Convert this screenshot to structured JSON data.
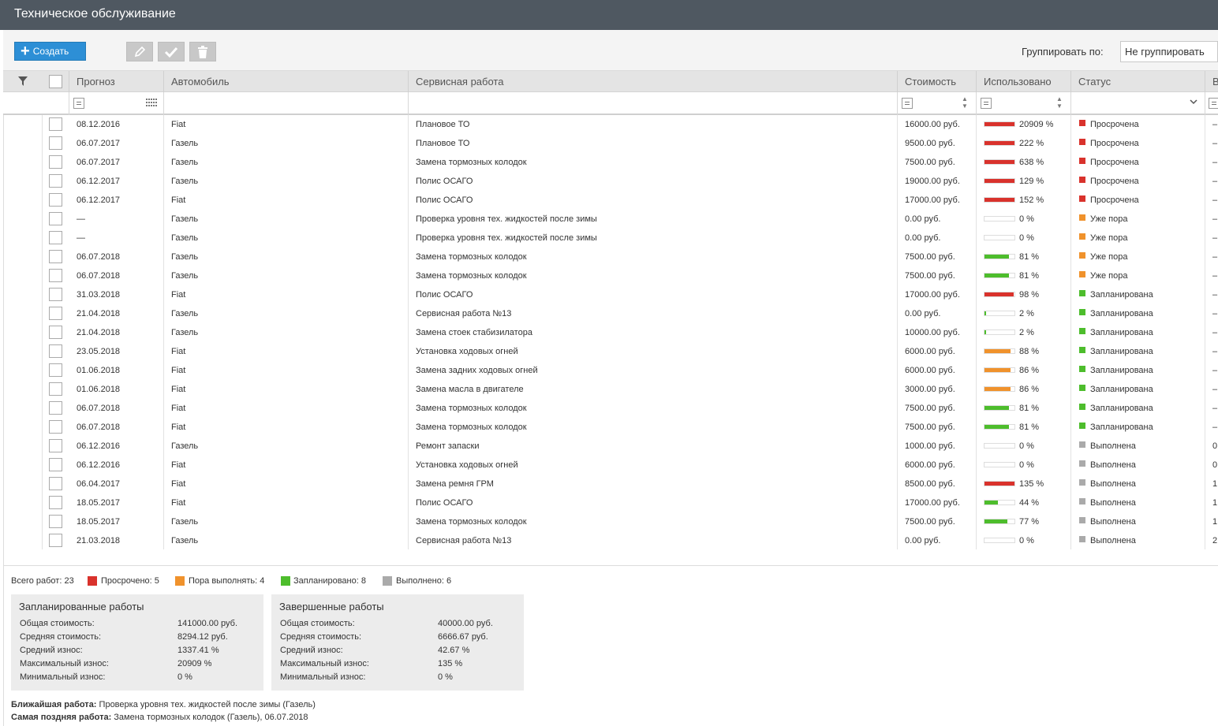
{
  "window": {
    "title": "Техническое обслуживание"
  },
  "toolbar": {
    "create_label": "Создать",
    "group_by_label": "Группировать по:",
    "group_by_value": "Не группировать"
  },
  "columns": {
    "forecast": "Прогноз",
    "car": "Автомобиль",
    "service": "Сервисная работа",
    "cost": "Стоимость",
    "used": "Использовано",
    "status": "Статус",
    "extra": "В"
  },
  "colors": {
    "red": "#d9322c",
    "orange": "#f0922c",
    "green": "#4dbd2c",
    "gray": "#aaaaaa"
  },
  "rows": [
    {
      "date": "08.12.2016",
      "car": "Fiat",
      "service": "Плановое ТО",
      "cost": "16000.00 руб.",
      "used": "20909 %",
      "used_fraction": 1.0,
      "bar_color": "red",
      "status": "Просрочена",
      "status_color": "red",
      "extra": "–"
    },
    {
      "date": "06.07.2017",
      "car": "Газель",
      "service": "Плановое ТО",
      "cost": "9500.00 руб.",
      "used": "222 %",
      "used_fraction": 1.0,
      "bar_color": "red",
      "status": "Просрочена",
      "status_color": "red",
      "extra": "–"
    },
    {
      "date": "06.07.2017",
      "car": "Газель",
      "service": "Замена тормозных колодок",
      "cost": "7500.00 руб.",
      "used": "638 %",
      "used_fraction": 1.0,
      "bar_color": "red",
      "status": "Просрочена",
      "status_color": "red",
      "extra": "–"
    },
    {
      "date": "06.12.2017",
      "car": "Газель",
      "service": "Полис ОСАГО",
      "cost": "19000.00 руб.",
      "used": "129 %",
      "used_fraction": 1.0,
      "bar_color": "red",
      "status": "Просрочена",
      "status_color": "red",
      "extra": "–"
    },
    {
      "date": "06.12.2017",
      "car": "Fiat",
      "service": "Полис ОСАГО",
      "cost": "17000.00 руб.",
      "used": "152 %",
      "used_fraction": 1.0,
      "bar_color": "red",
      "status": "Просрочена",
      "status_color": "red",
      "extra": "–"
    },
    {
      "date": "—",
      "car": "Газель",
      "service": "Проверка уровня тех. жидкостей после зимы",
      "cost": "0.00 руб.",
      "used": "0 %",
      "used_fraction": 0.0,
      "bar_color": "gray",
      "status": "Уже пора",
      "status_color": "orange",
      "extra": "–"
    },
    {
      "date": "—",
      "car": "Газель",
      "service": "Проверка уровня тех. жидкостей после зимы",
      "cost": "0.00 руб.",
      "used": "0 %",
      "used_fraction": 0.0,
      "bar_color": "gray",
      "status": "Уже пора",
      "status_color": "orange",
      "extra": "–"
    },
    {
      "date": "06.07.2018",
      "car": "Газель",
      "service": "Замена тормозных колодок",
      "cost": "7500.00 руб.",
      "used": "81 %",
      "used_fraction": 0.81,
      "bar_color": "green",
      "status": "Уже пора",
      "status_color": "orange",
      "extra": "–"
    },
    {
      "date": "06.07.2018",
      "car": "Газель",
      "service": "Замена тормозных колодок",
      "cost": "7500.00 руб.",
      "used": "81 %",
      "used_fraction": 0.81,
      "bar_color": "green",
      "status": "Уже пора",
      "status_color": "orange",
      "extra": "–"
    },
    {
      "date": "31.03.2018",
      "car": "Fiat",
      "service": "Полис ОСАГО",
      "cost": "17000.00 руб.",
      "used": "98 %",
      "used_fraction": 0.98,
      "bar_color": "red",
      "status": "Запланирована",
      "status_color": "green",
      "extra": "–"
    },
    {
      "date": "21.04.2018",
      "car": "Газель",
      "service": "Сервисная работа №13",
      "cost": "0.00 руб.",
      "used": "2 %",
      "used_fraction": 0.02,
      "bar_color": "green",
      "status": "Запланирована",
      "status_color": "green",
      "extra": "–"
    },
    {
      "date": "21.04.2018",
      "car": "Газель",
      "service": "Замена стоек стабизилатора",
      "cost": "10000.00 руб.",
      "used": "2 %",
      "used_fraction": 0.02,
      "bar_color": "green",
      "status": "Запланирована",
      "status_color": "green",
      "extra": "–"
    },
    {
      "date": "23.05.2018",
      "car": "Fiat",
      "service": "Установка ходовых огней",
      "cost": "6000.00 руб.",
      "used": "88 %",
      "used_fraction": 0.88,
      "bar_color": "orange",
      "status": "Запланирована",
      "status_color": "green",
      "extra": "–"
    },
    {
      "date": "01.06.2018",
      "car": "Fiat",
      "service": "Замена задних ходовых огней",
      "cost": "6000.00 руб.",
      "used": "86 %",
      "used_fraction": 0.86,
      "bar_color": "orange",
      "status": "Запланирована",
      "status_color": "green",
      "extra": "–"
    },
    {
      "date": "01.06.2018",
      "car": "Fiat",
      "service": "Замена масла в двигателе",
      "cost": "3000.00 руб.",
      "used": "86 %",
      "used_fraction": 0.86,
      "bar_color": "orange",
      "status": "Запланирована",
      "status_color": "green",
      "extra": "–"
    },
    {
      "date": "06.07.2018",
      "car": "Fiat",
      "service": "Замена тормозных колодок",
      "cost": "7500.00 руб.",
      "used": "81 %",
      "used_fraction": 0.81,
      "bar_color": "green",
      "status": "Запланирована",
      "status_color": "green",
      "extra": "–"
    },
    {
      "date": "06.07.2018",
      "car": "Fiat",
      "service": "Замена тормозных колодок",
      "cost": "7500.00 руб.",
      "used": "81 %",
      "used_fraction": 0.81,
      "bar_color": "green",
      "status": "Запланирована",
      "status_color": "green",
      "extra": "–"
    },
    {
      "date": "06.12.2016",
      "car": "Газель",
      "service": "Ремонт запаски",
      "cost": "1000.00 руб.",
      "used": "0 %",
      "used_fraction": 0.0,
      "bar_color": "gray",
      "status": "Выполнена",
      "status_color": "gray",
      "extra": "0"
    },
    {
      "date": "06.12.2016",
      "car": "Fiat",
      "service": "Установка ходовых огней",
      "cost": "6000.00 руб.",
      "used": "0 %",
      "used_fraction": 0.0,
      "bar_color": "gray",
      "status": "Выполнена",
      "status_color": "gray",
      "extra": "0"
    },
    {
      "date": "06.04.2017",
      "car": "Fiat",
      "service": "Замена ремня ГРМ",
      "cost": "8500.00 руб.",
      "used": "135 %",
      "used_fraction": 1.0,
      "bar_color": "red",
      "status": "Выполнена",
      "status_color": "gray",
      "extra": "1"
    },
    {
      "date": "18.05.2017",
      "car": "Fiat",
      "service": "Полис ОСАГО",
      "cost": "17000.00 руб.",
      "used": "44 %",
      "used_fraction": 0.44,
      "bar_color": "green",
      "status": "Выполнена",
      "status_color": "gray",
      "extra": "1"
    },
    {
      "date": "18.05.2017",
      "car": "Газель",
      "service": "Замена тормозных колодок",
      "cost": "7500.00 руб.",
      "used": "77 %",
      "used_fraction": 0.77,
      "bar_color": "green",
      "status": "Выполнена",
      "status_color": "gray",
      "extra": "1"
    },
    {
      "date": "21.03.2018",
      "car": "Газель",
      "service": "Сервисная работа №13",
      "cost": "0.00 руб.",
      "used": "0 %",
      "used_fraction": 0.0,
      "bar_color": "gray",
      "status": "Выполнена",
      "status_color": "gray",
      "extra": "2"
    }
  ],
  "summary": {
    "total": "Всего работ: 23",
    "overdue": "Просрочено: 5",
    "due": "Пора выполнять: 4",
    "planned": "Запланировано: 8",
    "done": "Выполнено: 6"
  },
  "planned_panel": {
    "title": "Запланированные работы",
    "labels": [
      "Общая стоимость:",
      "Средняя стоимость:",
      "Средний износ:",
      "Максимальный износ:",
      "Минимальный износ:"
    ],
    "values": [
      "141000.00 руб.",
      "8294.12 руб.",
      "1337.41 %",
      "20909 %",
      "0 %"
    ]
  },
  "done_panel": {
    "title": "Завершенные работы",
    "labels": [
      "Общая стоимость:",
      "Средняя стоимость:",
      "Средний износ:",
      "Максимальный износ:",
      "Минимальный износ:"
    ],
    "values": [
      "40000.00 руб.",
      "6666.67 руб.",
      "42.67 %",
      "135 %",
      "0 %"
    ]
  },
  "footer": {
    "nearest_label": "Ближайшая работа:",
    "nearest_value": " Проверка уровня тех. жидкостей после зимы (Газель)",
    "latest_label": "Самая поздняя работа:",
    "latest_value": " Замена тормозных колодок (Газель), 06.07.2018"
  }
}
